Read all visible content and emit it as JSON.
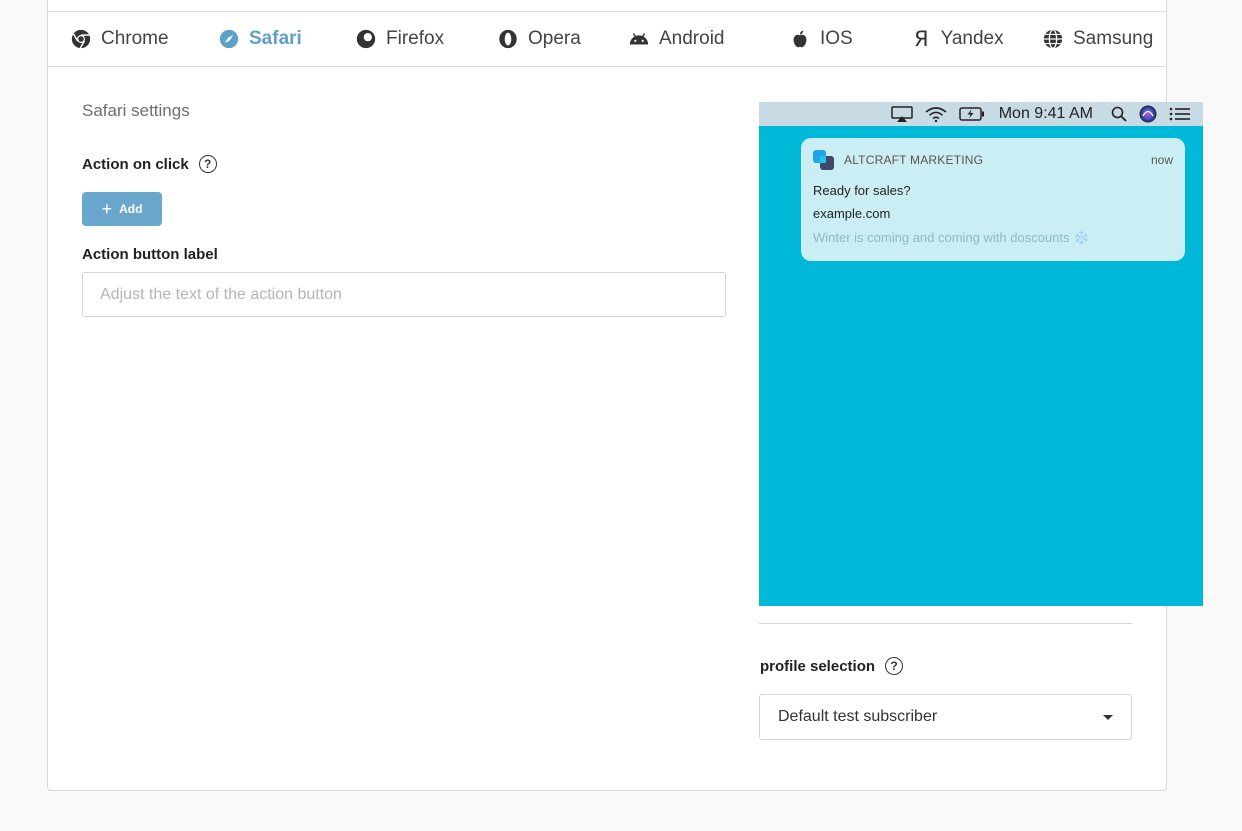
{
  "tabs": [
    {
      "label": "Chrome",
      "icon": "chrome-icon",
      "active": false
    },
    {
      "label": "Safari",
      "icon": "safari-icon",
      "active": true
    },
    {
      "label": "Firefox",
      "icon": "firefox-icon",
      "active": false
    },
    {
      "label": "Opera",
      "icon": "opera-icon",
      "active": false
    },
    {
      "label": "Android",
      "icon": "android-icon",
      "active": false
    },
    {
      "label": "IOS",
      "icon": "apple-icon",
      "active": false
    },
    {
      "label": "Yandex",
      "icon": "yandex-icon",
      "active": false
    },
    {
      "label": "Samsung",
      "icon": "globe-icon",
      "active": false
    }
  ],
  "settings": {
    "heading": "Safari settings",
    "action_on_click_label": "Action on click",
    "add_button_label": "Add",
    "action_button_label": "Action button label",
    "action_button_placeholder": "Adjust the text of the action button"
  },
  "preview": {
    "menubar_time": "Mon 9:41 AM",
    "notification": {
      "app_name": "ALTCRAFT MARKETING",
      "time": "now",
      "title": "Ready for sales?",
      "site": "example.com",
      "body": "Winter is coming and coming with doscounts ❄️"
    }
  },
  "profile": {
    "label": "profile selection",
    "selected": "Default test subscriber"
  },
  "colors": {
    "accent": "#5ea1c8",
    "button": "#6aa7cc",
    "preview_background": "#00b8d8",
    "notification_background": "#cbeef5"
  }
}
